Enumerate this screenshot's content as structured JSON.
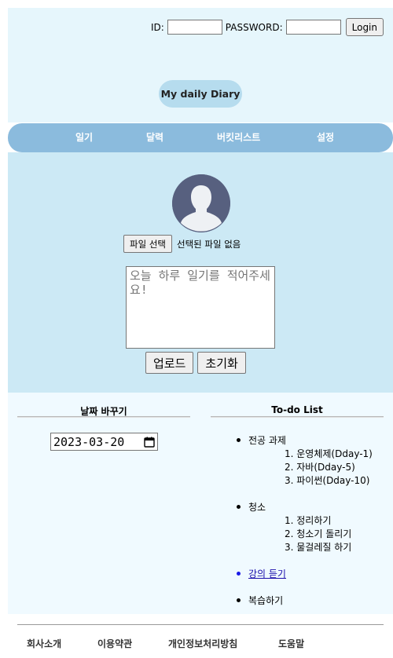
{
  "login": {
    "id_label": "ID:",
    "id_value": "",
    "password_label": "PASSWORD:",
    "password_value": "",
    "login_button": "Login"
  },
  "logo": {
    "text": "My daily Diary"
  },
  "nav": {
    "items": [
      {
        "label": "일기"
      },
      {
        "label": "달력"
      },
      {
        "label": "버킷리스트"
      },
      {
        "label": "설정"
      }
    ]
  },
  "diary": {
    "file_button": "파일 선택",
    "file_status": "선택된 파일 없음",
    "placeholder": "오늘 하루 일기를 적어주세요!",
    "upload_button": "업로드",
    "reset_button": "초기화"
  },
  "date_section": {
    "title": "날짜 바꾸기",
    "date_value": "2023-03-20"
  },
  "todo": {
    "title": "To-do List",
    "items": [
      {
        "label": "전공 과제",
        "subitems": [
          "1. 운영체제(Dday-1)",
          "2. 자바(Dday-5)",
          "3. 파이썬(Dday-10)"
        ]
      },
      {
        "label": "청소",
        "subitems": [
          "1. 정리하기",
          "2. 청소기 돌리기",
          "3. 물걸레질 하기"
        ]
      },
      {
        "label": "강의 듣기"
      },
      {
        "label": "복습하기"
      }
    ]
  },
  "footer": {
    "items": [
      {
        "label": "회사소개"
      },
      {
        "label": "이용약관"
      },
      {
        "label": "개인정보처리방침"
      },
      {
        "label": "도움말"
      }
    ]
  },
  "colors": {
    "header_bg": "#e6f6fc",
    "nav_bg": "#8bbbdd",
    "main_bg": "#cce9f5",
    "logo_bg": "#b6dcee",
    "lower_bg": "#f0faff",
    "avatar_bg": "#57607f"
  },
  "icons": {
    "avatar": "user-avatar-icon",
    "calendar": "calendar-icon"
  }
}
